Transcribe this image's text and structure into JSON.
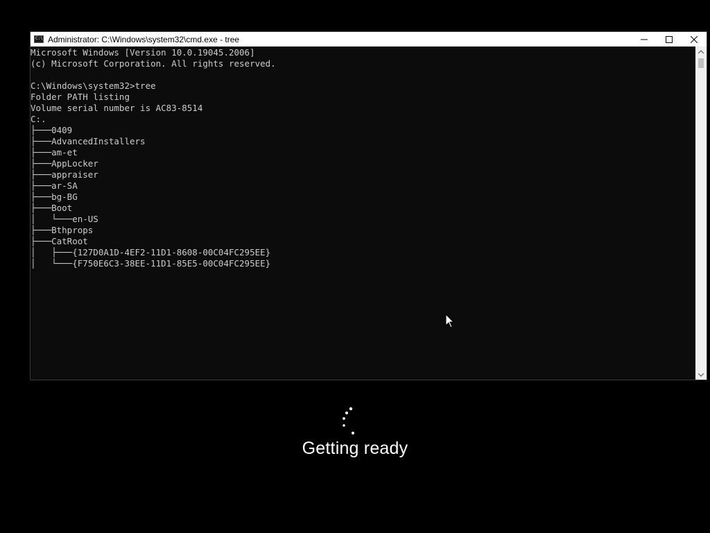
{
  "window": {
    "title": "Administrator: C:\\Windows\\system32\\cmd.exe - tree",
    "icon": "cmd-icon",
    "controls": [
      "minimize",
      "maximize",
      "close"
    ]
  },
  "console": {
    "lines": [
      "Microsoft Windows [Version 10.0.19045.2006]",
      "(c) Microsoft Corporation. All rights reserved.",
      "",
      "C:\\Windows\\system32>tree",
      "Folder PATH listing",
      "Volume serial number is AC83-8514",
      "C:.",
      "├───0409",
      "├───AdvancedInstallers",
      "├───am-et",
      "├───AppLocker",
      "├───appraiser",
      "├───ar-SA",
      "├───bg-BG",
      "├───Boot",
      "│   └───en-US",
      "├───Bthprops",
      "├───CatRoot",
      "│   ├───{127D0A1D-4EF2-11D1-8608-00C04FC295EE}",
      "│   └───{F750E6C3-38EE-11D1-85E5-00C04FC295EE}"
    ]
  },
  "overlay": {
    "status_text": "Getting ready"
  }
}
